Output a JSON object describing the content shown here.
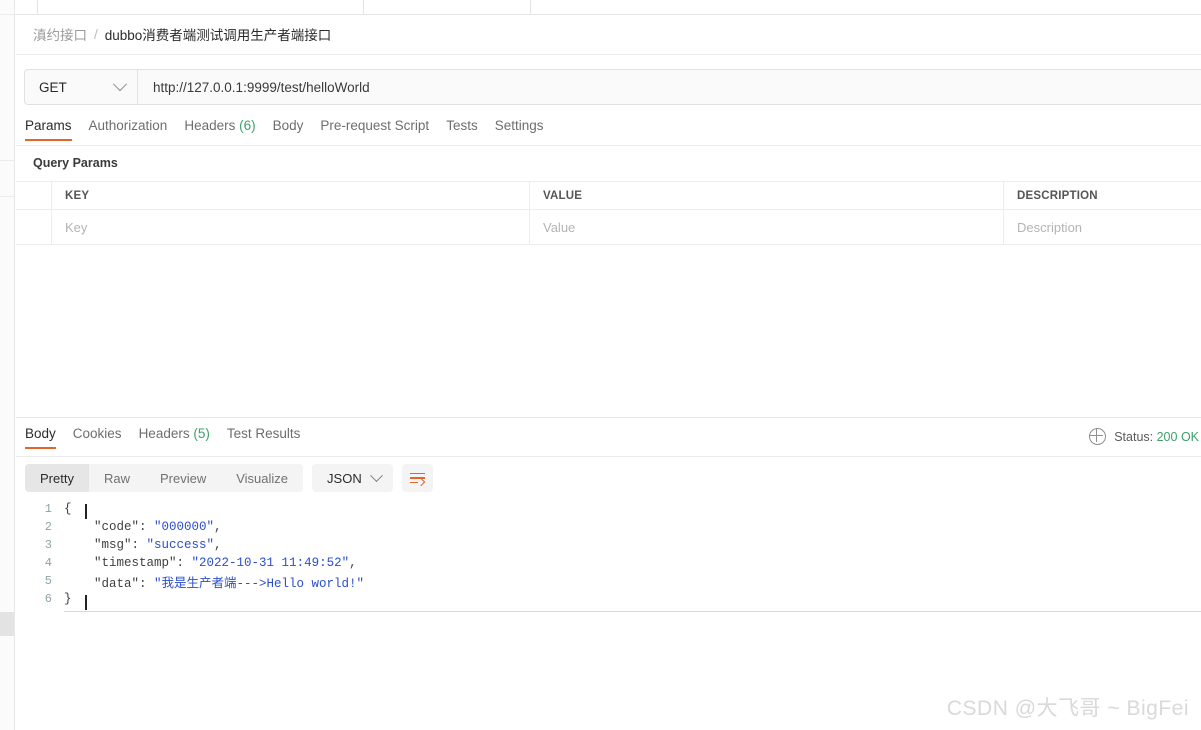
{
  "window": {
    "left_rail": "collapsed-sidebar-rail"
  },
  "breadcrumb": {
    "parent": "滇约接口",
    "separator": "/",
    "current": "dubbo消费者端测试调用生产者端接口"
  },
  "request": {
    "method": "GET",
    "url": "http://127.0.0.1:9999/test/helloWorld",
    "tabs": [
      {
        "label": "Params",
        "count": "",
        "active": true
      },
      {
        "label": "Authorization",
        "count": "",
        "active": false
      },
      {
        "label": "Headers",
        "count": "(6)",
        "active": false
      },
      {
        "label": "Body",
        "count": "",
        "active": false
      },
      {
        "label": "Pre-request Script",
        "count": "",
        "active": false
      },
      {
        "label": "Tests",
        "count": "",
        "active": false
      },
      {
        "label": "Settings",
        "count": "",
        "active": false
      }
    ]
  },
  "query_params": {
    "section_title": "Query Params",
    "headers": [
      "KEY",
      "VALUE",
      "DESCRIPTION"
    ],
    "rows": [
      {
        "key": "Key",
        "value": "Value",
        "description": "Description"
      }
    ]
  },
  "response": {
    "tabs": [
      {
        "label": "Body",
        "count": "",
        "active": true
      },
      {
        "label": "Cookies",
        "count": "",
        "active": false
      },
      {
        "label": "Headers",
        "count": "(5)",
        "active": false
      },
      {
        "label": "Test Results",
        "count": "",
        "active": false
      }
    ],
    "status": {
      "label": "Status:",
      "value": "200 OK",
      "color": "#3ea06a"
    },
    "view_modes": [
      {
        "label": "Pretty",
        "active": true
      },
      {
        "label": "Raw",
        "active": false
      },
      {
        "label": "Preview",
        "active": false
      },
      {
        "label": "Visualize",
        "active": false
      }
    ],
    "format": "JSON",
    "wrap_icon": "wrap-lines-icon",
    "body": {
      "lines": [
        {
          "num": "1",
          "tokens": [
            {
              "t": "{",
              "c": "p"
            }
          ]
        },
        {
          "num": "2",
          "tokens": [
            {
              "t": "    \"code\"",
              "c": "k"
            },
            {
              "t": ": ",
              "c": "p"
            },
            {
              "t": "\"000000\"",
              "c": "v"
            },
            {
              "t": ",",
              "c": "p"
            }
          ]
        },
        {
          "num": "3",
          "tokens": [
            {
              "t": "    \"msg\"",
              "c": "k"
            },
            {
              "t": ": ",
              "c": "p"
            },
            {
              "t": "\"success\"",
              "c": "v"
            },
            {
              "t": ",",
              "c": "p"
            }
          ]
        },
        {
          "num": "4",
          "tokens": [
            {
              "t": "    \"timestamp\"",
              "c": "k"
            },
            {
              "t": ": ",
              "c": "p"
            },
            {
              "t": "\"2022-10-31 11:49:52\"",
              "c": "v"
            },
            {
              "t": ",",
              "c": "p"
            }
          ]
        },
        {
          "num": "5",
          "tokens": [
            {
              "t": "    \"data\"",
              "c": "k"
            },
            {
              "t": ": ",
              "c": "p"
            },
            {
              "t": "\"我是生产者端--->Hello world!\"",
              "c": "v"
            }
          ]
        },
        {
          "num": "6",
          "tokens": [
            {
              "t": "}",
              "c": "p"
            }
          ]
        }
      ]
    }
  },
  "watermark": "CSDN @大飞哥 ~ BigFei",
  "colors": {
    "accent": "#e0662c",
    "success": "#3ea06a",
    "json_value": "#2b4ecb"
  }
}
